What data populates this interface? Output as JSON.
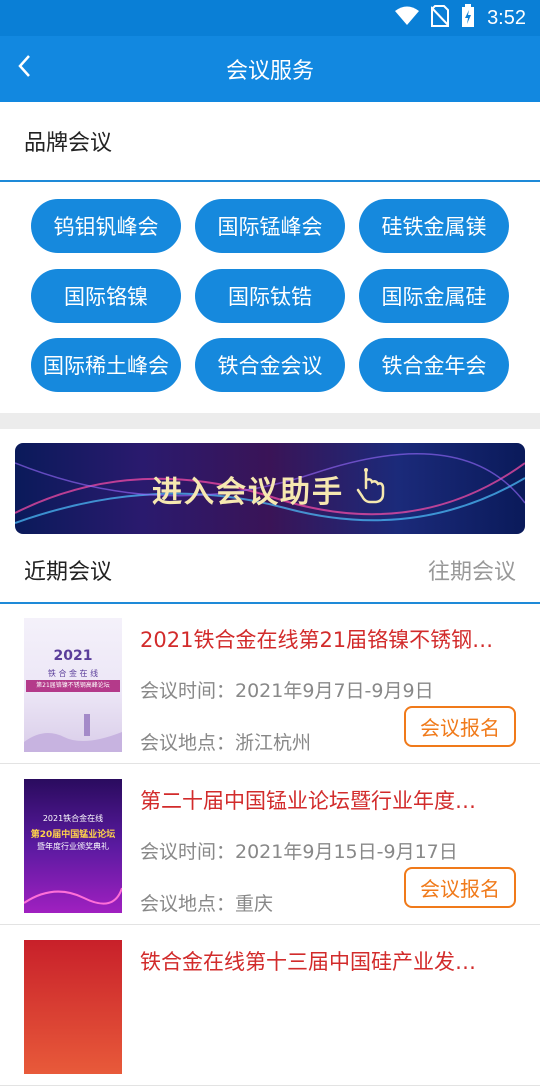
{
  "status_bar": {
    "time": "3:52",
    "icons": [
      "wifi-icon",
      "no-sim-icon",
      "battery-charging-icon"
    ]
  },
  "app_bar": {
    "title": "会议服务",
    "back_icon": "chevron-left-icon"
  },
  "brand_section": {
    "heading": "品牌会议",
    "items": [
      "钨钼钒峰会",
      "国际锰峰会",
      "硅铁金属镁",
      "国际铬镍",
      "国际钛锆",
      "国际金属硅",
      "国际稀土峰会",
      "铁合金会议",
      "铁合金年会"
    ]
  },
  "banner": {
    "label": "进入会议助手",
    "icon": "tap-hand-icon"
  },
  "tabs": {
    "recent": "近期会议",
    "past": "往期会议"
  },
  "meetings": [
    {
      "title": "2021铁合金在线第21届铬镍不锈钢…",
      "time": "会议时间：2021年9月7日-9月9日",
      "place": "会议地点：浙江杭州",
      "button": "会议报名",
      "thumb": {
        "year": "2021",
        "sub": "铁 合 金 在 线",
        "line": "第21届铬镍不锈钢高峰论坛"
      }
    },
    {
      "title": "第二十届中国锰业论坛暨行业年度…",
      "time": "会议时间：2021年9月15日-9月17日",
      "place": "会议地点：重庆",
      "button": "会议报名",
      "thumb": {
        "year": "2021铁合金在线",
        "sub": "第20届中国锰业论坛",
        "line": "暨年度行业颁奖典礼"
      }
    },
    {
      "title": "铁合金在线第十三届中国硅产业发…",
      "time": "",
      "place": "",
      "button": "",
      "thumb": {
        "year": "",
        "sub": "",
        "line": ""
      }
    }
  ],
  "colors": {
    "primary": "#1288e0",
    "pill": "#1689dd",
    "title_red": "#d22b2b",
    "accent_orange": "#f07a1a"
  }
}
